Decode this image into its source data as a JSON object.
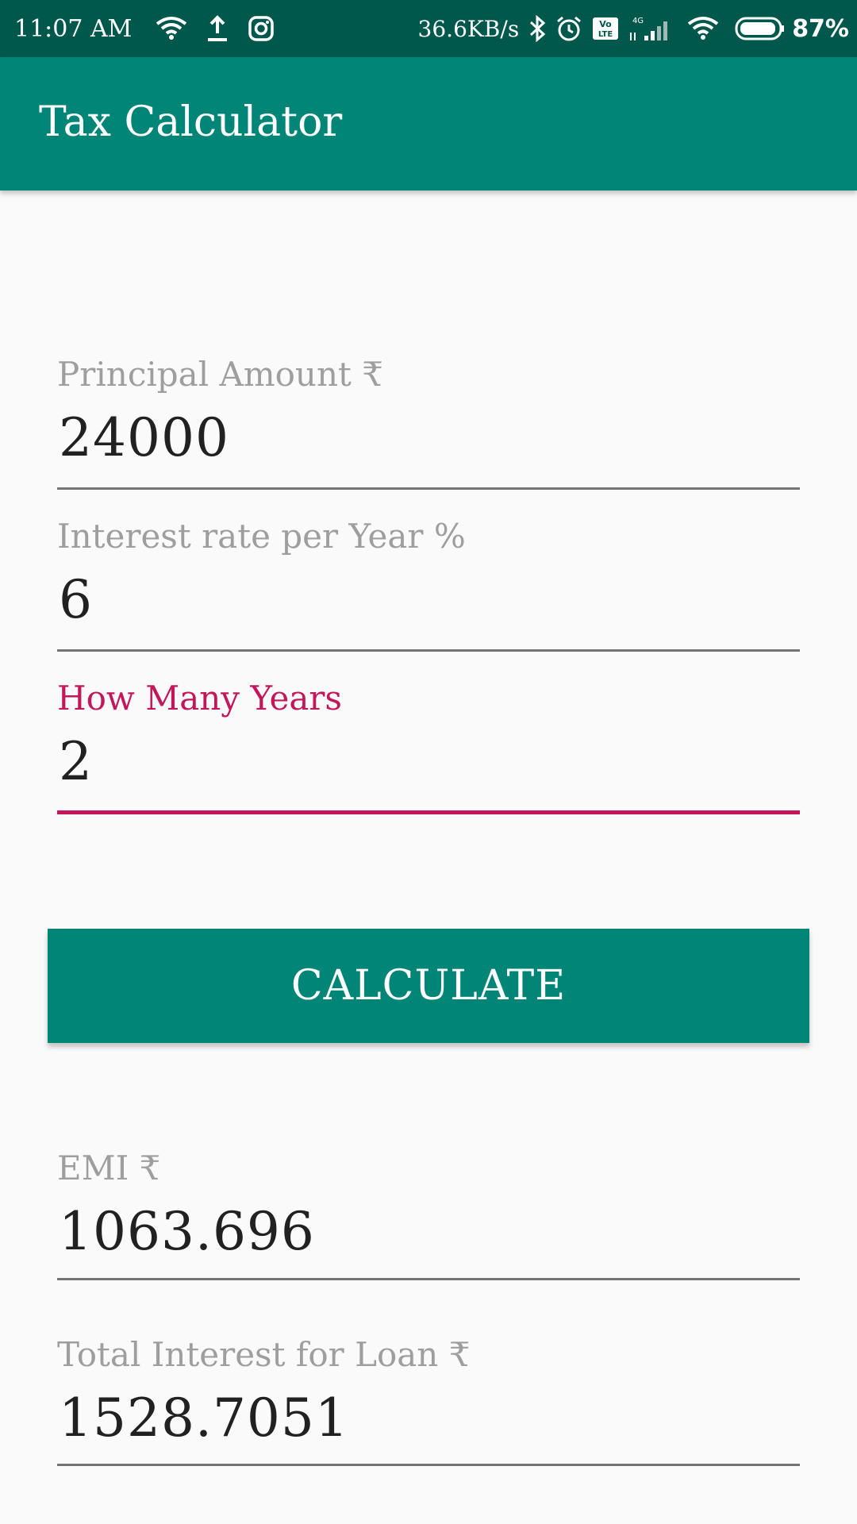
{
  "status_bar": {
    "time": "11:07 AM",
    "net_speed": "36.6KB/s",
    "battery": "87%",
    "network_label": "4G",
    "icons": [
      "wifi-icon",
      "upload-icon",
      "instagram-icon",
      "bluetooth-icon",
      "alarm-icon",
      "volte-icon",
      "signal-icon",
      "wifi-icon",
      "battery-icon"
    ]
  },
  "app_bar": {
    "title": "Tax Calculator"
  },
  "form": {
    "principal": {
      "label": "Principal Amount ₹",
      "value": "24000"
    },
    "rate": {
      "label": "Interest rate per Year %",
      "value": "6"
    },
    "years": {
      "label": "How Many Years",
      "value": "2"
    }
  },
  "calculate_label": "CALCULATE",
  "results": {
    "emi": {
      "label": "EMI ₹",
      "value": "1063.696"
    },
    "total_interest": {
      "label": "Total Interest for Loan ₹",
      "value": "1528.7051"
    }
  },
  "colors": {
    "status_bar": "#00574b",
    "primary": "#008577",
    "accent": "#c2185b",
    "background": "#fafafa",
    "hint_text": "#9e9e9e",
    "value_text": "#212121"
  }
}
